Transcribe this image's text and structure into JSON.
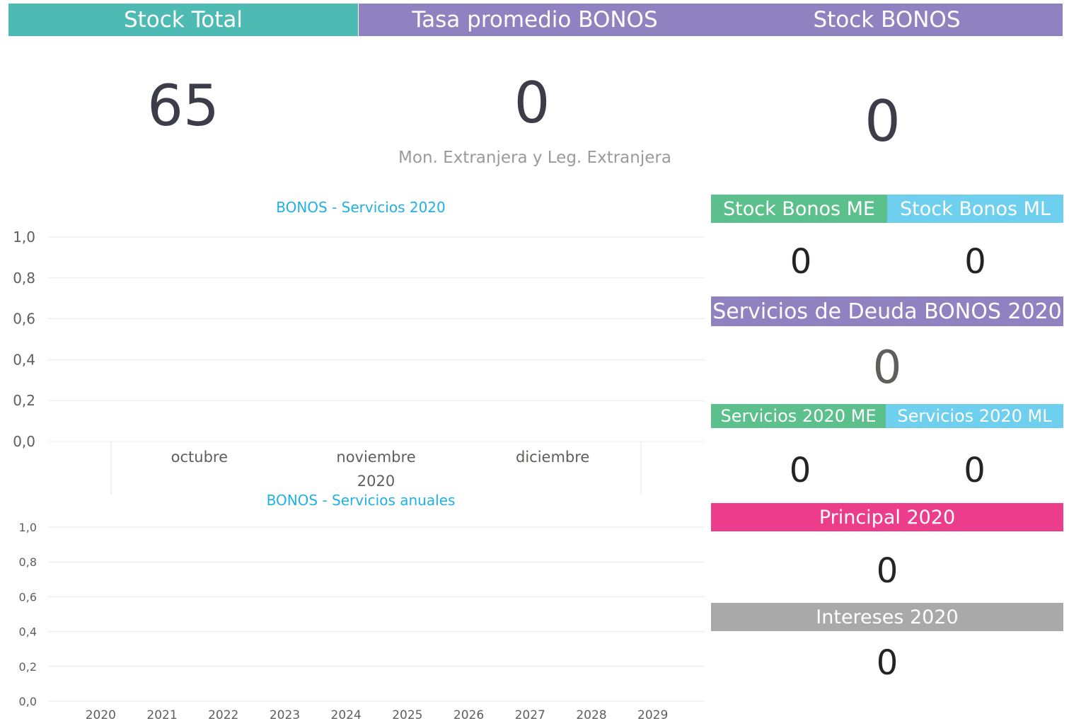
{
  "colors": {
    "teal": "#4dbab3",
    "purple": "#9082c0",
    "green": "#5bc08b",
    "lightblue": "#6fcfee",
    "pink": "#ec3d8d",
    "gray": "#a8a9a8",
    "title_blue": "#1fb1e6",
    "value_dark": "#3d3d4a"
  },
  "kpi": {
    "stock_total": {
      "label": "Stock Total",
      "value": "65"
    },
    "tasa_bonos": {
      "label": "Tasa promedio BONOS",
      "value": "0",
      "subtitle": "Mon. Extranjera y Leg. Extranjera"
    },
    "stock_bonos": {
      "label": "Stock BONOS",
      "value": "0"
    }
  },
  "side": {
    "stock_me": {
      "label": "Stock Bonos ME",
      "value": "0"
    },
    "stock_ml": {
      "label": "Stock Bonos ML",
      "value": "0"
    },
    "servicios_deuda": {
      "label": "Servicios de Deuda BONOS 2020",
      "value": "0"
    },
    "serv_me": {
      "label": "Servicios 2020 ME",
      "value": "0"
    },
    "serv_ml": {
      "label": "Servicios 2020 ML",
      "value": "0"
    },
    "principal": {
      "label": "Principal 2020",
      "value": "0"
    },
    "intereses": {
      "label": "Intereses 2020",
      "value": "0"
    }
  },
  "chart_data": [
    {
      "type": "bar",
      "title": "BONOS - Servicios 2020",
      "categories": [
        "octubre",
        "noviembre",
        "diciembre"
      ],
      "group_label": "2020",
      "y_ticks": [
        "1,0",
        "0,8",
        "0,6",
        "0,4",
        "0,2",
        "0,0"
      ],
      "ylim": [
        0,
        1
      ],
      "values": [],
      "grid": true
    },
    {
      "type": "bar",
      "title": "BONOS - Servicios anuales",
      "categories": [
        "2020",
        "2021",
        "2022",
        "2023",
        "2024",
        "2025",
        "2026",
        "2027",
        "2028",
        "2029"
      ],
      "y_ticks": [
        "1,0",
        "0,8",
        "0,6",
        "0,4",
        "0,2",
        "0,0"
      ],
      "ylim": [
        0,
        1
      ],
      "values": [],
      "grid": true
    }
  ]
}
